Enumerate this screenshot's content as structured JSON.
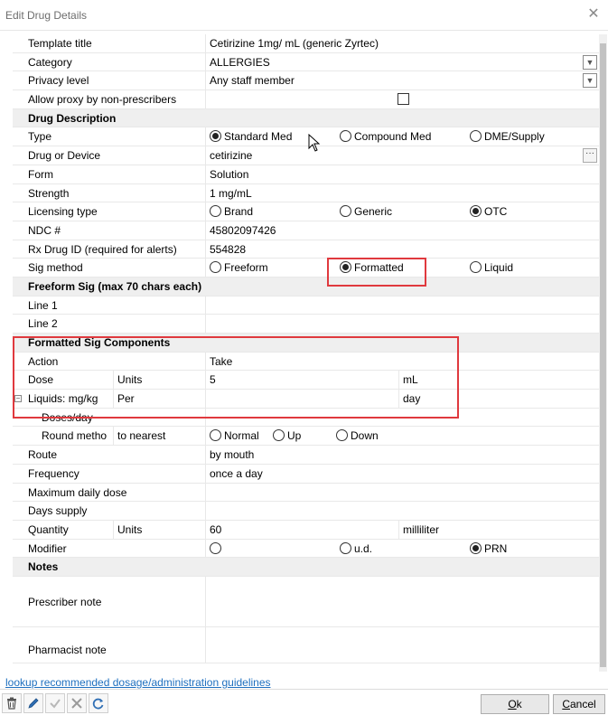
{
  "window": {
    "title": "Edit Drug Details",
    "close": "✕"
  },
  "rows": {
    "template_title": {
      "label": "Template title",
      "value": "Cetirizine 1mg/ mL (generic Zyrtec)"
    },
    "category": {
      "label": "Category",
      "value": "ALLERGIES"
    },
    "privacy": {
      "label": "Privacy level",
      "value": "Any staff member"
    },
    "allow_proxy": {
      "label": "Allow proxy by non-prescribers",
      "checked": false
    },
    "drug_description": {
      "label": "Drug Description"
    },
    "type": {
      "label": "Type",
      "options": [
        "Standard Med",
        "Compound Med",
        "DME/Supply"
      ],
      "selected": "Standard Med"
    },
    "drug_device": {
      "label": "Drug or Device",
      "value": "cetirizine",
      "button": "···"
    },
    "form": {
      "label": "Form",
      "value": "Solution"
    },
    "strength": {
      "label": "Strength",
      "value": "1 mg/mL"
    },
    "licensing": {
      "label": "Licensing type",
      "options": [
        "Brand",
        "Generic",
        "OTC"
      ],
      "selected": "OTC"
    },
    "ndc": {
      "label": "NDC #",
      "value": "45802097426"
    },
    "rx_id": {
      "label": "Rx Drug ID (required for alerts)",
      "value": "554828"
    },
    "sig_method": {
      "label": "Sig method",
      "options": [
        "Freeform",
        "Formatted",
        "Liquid"
      ],
      "selected": "Formatted"
    },
    "freeform_header": {
      "label": "Freeform Sig (max 70 chars each)"
    },
    "line1": {
      "label": "Line 1",
      "value": ""
    },
    "line2": {
      "label": "Line 2",
      "value": ""
    },
    "formatted_header": {
      "label": "Formatted Sig Components"
    },
    "action": {
      "label": "Action",
      "value": "Take"
    },
    "dose": {
      "label": "Dose",
      "sub": "Units",
      "value": "5",
      "unit": "mL"
    },
    "liquids": {
      "label": "Liquids: mg/kg",
      "sub": "Per",
      "value": "",
      "unit": "day",
      "expander": "⊟"
    },
    "doses_day": {
      "label": "Doses/day",
      "value": ""
    },
    "round": {
      "label": "Round metho",
      "sub": "to nearest",
      "options": [
        "Normal",
        "Up",
        "Down"
      ],
      "selected": ""
    },
    "route": {
      "label": "Route",
      "value": "by mouth"
    },
    "frequency": {
      "label": "Frequency",
      "value": "once a day"
    },
    "max_daily": {
      "label": "Maximum daily dose",
      "value": ""
    },
    "days_supply": {
      "label": "Days supply",
      "value": ""
    },
    "quantity": {
      "label": "Quantity",
      "sub": "Units",
      "value": "60",
      "unit": "milliliter"
    },
    "modifier": {
      "label": "Modifier",
      "options": [
        "",
        "u.d.",
        "PRN"
      ],
      "selected": "PRN"
    },
    "notes_header": {
      "label": "Notes"
    },
    "prescriber_note": {
      "label": "Prescriber note",
      "value": ""
    },
    "pharmacist_note": {
      "label": "Pharmacist note",
      "value": ""
    }
  },
  "footer": {
    "link": "lookup recommended dosage/administration guidelines",
    "ok": {
      "accel": "O",
      "rest": "k"
    },
    "cancel": {
      "accel": "C",
      "rest": "ancel"
    }
  },
  "colors": {
    "highlight": "#e0393e",
    "link": "#1e6fbf",
    "section_bg": "#efefef"
  },
  "icons": [
    "trash-icon",
    "pencil-icon",
    "check-icon",
    "x-icon",
    "refresh-icon",
    "chevron-down-icon",
    "mouse-cursor-icon"
  ]
}
